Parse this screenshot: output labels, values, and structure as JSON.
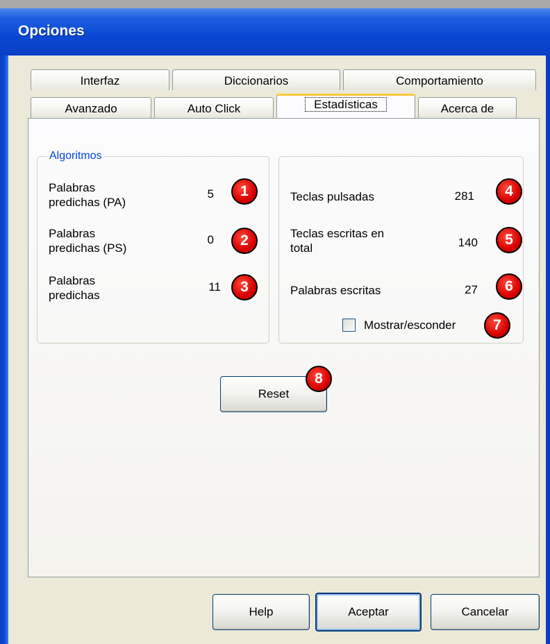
{
  "window": {
    "title": "Opciones"
  },
  "tabs": {
    "row1": [
      "Interfaz",
      "Diccionarios",
      "Comportamiento"
    ],
    "row2": [
      "Avanzado",
      "Auto Click",
      "Estadísticas",
      "Acerca de"
    ],
    "active": "Estadísticas"
  },
  "algoritmos": {
    "legend": "Algoritmos",
    "items": [
      {
        "label_line1": "Palabras",
        "label_line2": "predichas (PA)",
        "value": "5",
        "badge": "1"
      },
      {
        "label_line1": "Palabras",
        "label_line2": "predichas (PS)",
        "value": "0",
        "badge": "2"
      },
      {
        "label_line1": "Palabras",
        "label_line2": "predichas",
        "value": "11",
        "badge": "3"
      }
    ]
  },
  "stats": {
    "items": [
      {
        "label_line1": "Teclas pulsadas",
        "label_line2": "",
        "value": "281",
        "badge": "4"
      },
      {
        "label_line1": "Teclas escritas en",
        "label_line2": "total",
        "value": "140",
        "badge": "5"
      },
      {
        "label_line1": "Palabras escritas",
        "label_line2": "",
        "value": "27",
        "badge": "6"
      }
    ],
    "toggle_label": "Mostrar/esconder",
    "toggle_checked": false,
    "toggle_badge": "7"
  },
  "reset": {
    "label": "Reset",
    "badge": "8"
  },
  "footer": {
    "help_label": "Help",
    "accept_label": "Aceptar",
    "cancel_label": "Cancelar"
  },
  "colors": {
    "title_bar": "#0a47d3",
    "legend_text": "#0046d5",
    "badge": "#d80000",
    "active_tab_accent": "#ffc83c"
  }
}
